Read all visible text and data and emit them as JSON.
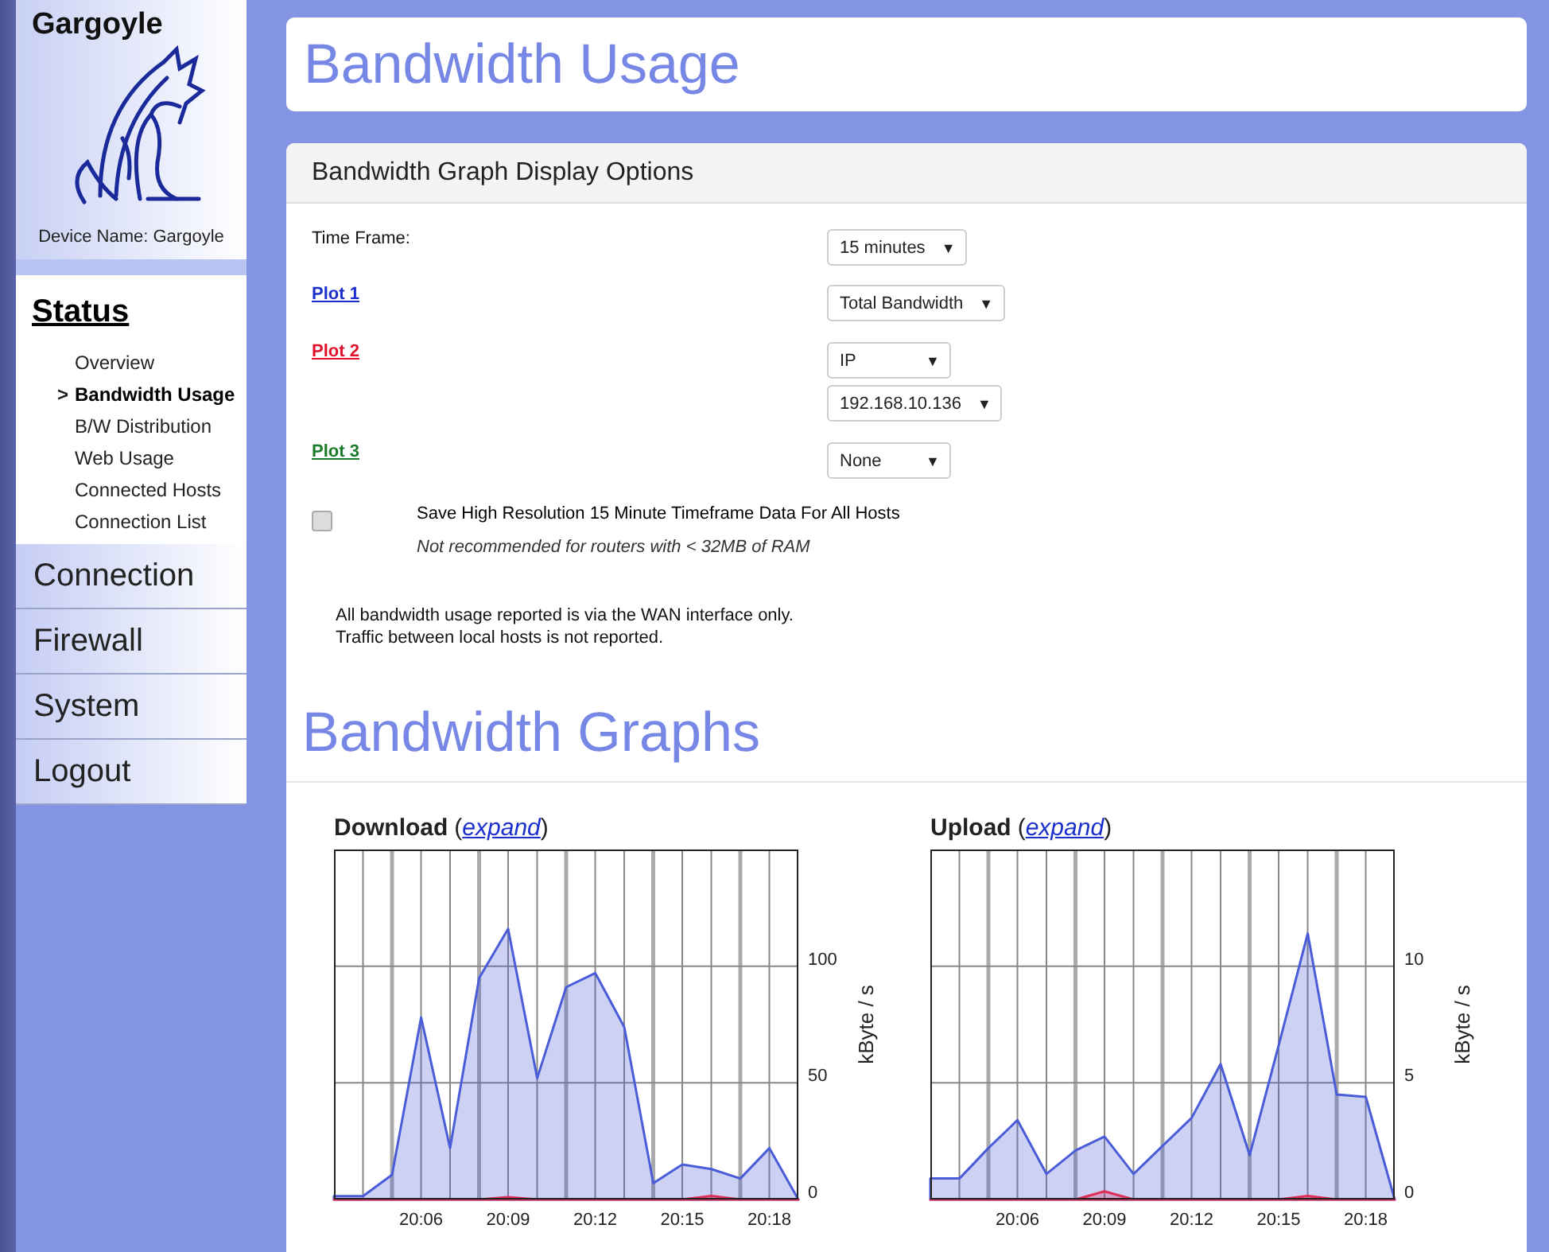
{
  "sidebar": {
    "brand": "Gargoyle",
    "device_label": "Device Name: Gargoyle",
    "selected_marker": ">",
    "sections": [
      {
        "label": "Status",
        "selected": true,
        "expanded": true,
        "children": [
          {
            "label": "Overview",
            "selected": false
          },
          {
            "label": "Bandwidth Usage",
            "selected": true
          },
          {
            "label": "B/W Distribution",
            "selected": false
          },
          {
            "label": "Web Usage",
            "selected": false
          },
          {
            "label": "Connected Hosts",
            "selected": false
          },
          {
            "label": "Connection List",
            "selected": false
          }
        ]
      },
      {
        "label": "Connection",
        "selected": false,
        "expanded": false
      },
      {
        "label": "Firewall",
        "selected": false,
        "expanded": false
      },
      {
        "label": "System",
        "selected": false,
        "expanded": false
      },
      {
        "label": "Logout",
        "selected": false,
        "expanded": false
      }
    ]
  },
  "page_title": "Bandwidth Usage",
  "options": {
    "header": "Bandwidth Graph Display Options",
    "caret": "▼",
    "rows": [
      {
        "label": "Time Frame:",
        "kind": "text",
        "selects": [
          "15 minutes"
        ]
      },
      {
        "label": "Plot 1",
        "kind": "link",
        "color": "#1a2fcc",
        "selects": [
          "Total Bandwidth"
        ]
      },
      {
        "label": "Plot 2",
        "kind": "link",
        "color": "#e0102a",
        "selects": [
          "IP",
          "192.168.10.136"
        ]
      },
      {
        "label": "Plot 3",
        "kind": "link",
        "color": "#1a7a2a",
        "selects": [
          "None"
        ]
      }
    ],
    "checkbox": {
      "label": "Save High Resolution 15 Minute Timeframe Data For All Hosts",
      "note": "Not recommended for routers with < 32MB of RAM",
      "checked": false
    },
    "info": [
      "All bandwidth usage reported is via the WAN interface only.",
      "Traffic between local hosts is not reported."
    ]
  },
  "graphs": {
    "heading": "Bandwidth Graphs",
    "items": [
      {
        "title": "Download",
        "paren_open": "(",
        "link": "expand",
        "paren_close": ")",
        "chart_data": {
          "type": "area",
          "ylabel": "kByte / s",
          "categories": [
            null,
            null,
            null,
            "20:06",
            null,
            null,
            "20:09",
            null,
            null,
            "20:12",
            null,
            null,
            "20:15",
            null,
            null,
            "20:18",
            null
          ],
          "series": [
            {
              "color": "#4a5cd8",
              "values": [
                1.4,
                1.4,
                10.6,
                78,
                22,
                95,
                116,
                52,
                91,
                97,
                74,
                7,
                15,
                13,
                9,
                22,
                0
              ]
            },
            {
              "color": "#e0305a",
              "values": [
                0,
                0,
                0,
                0,
                0,
                0,
                1,
                0,
                0,
                0,
                0,
                0,
                0,
                1.5,
                0,
                0,
                0
              ]
            }
          ],
          "ylim": [
            0,
            150
          ],
          "yticks": [
            0,
            50,
            100
          ],
          "grid": true
        }
      },
      {
        "title": "Upload",
        "paren_open": "(",
        "link": "expand",
        "paren_close": ")",
        "chart_data": {
          "type": "area",
          "ylabel": "kByte / s",
          "categories": [
            null,
            null,
            null,
            "20:06",
            null,
            null,
            "20:09",
            null,
            null,
            "20:12",
            null,
            null,
            "20:15",
            null,
            null,
            "20:18",
            null
          ],
          "series": [
            {
              "color": "#4a5cd8",
              "values": [
                0.9,
                0.9,
                2.2,
                3.4,
                1.1,
                2.1,
                2.7,
                1.1,
                2.3,
                3.5,
                5.8,
                1.9,
                6.6,
                11.4,
                4.5,
                4.4,
                0
              ]
            },
            {
              "color": "#e0305a",
              "values": [
                0,
                0,
                0,
                0,
                0,
                0,
                0.35,
                0,
                0,
                0,
                0,
                0,
                0,
                0.15,
                0,
                0,
                0
              ]
            }
          ],
          "ylim": [
            0,
            15
          ],
          "yticks": [
            0,
            5,
            10
          ],
          "grid": true
        }
      }
    ]
  }
}
